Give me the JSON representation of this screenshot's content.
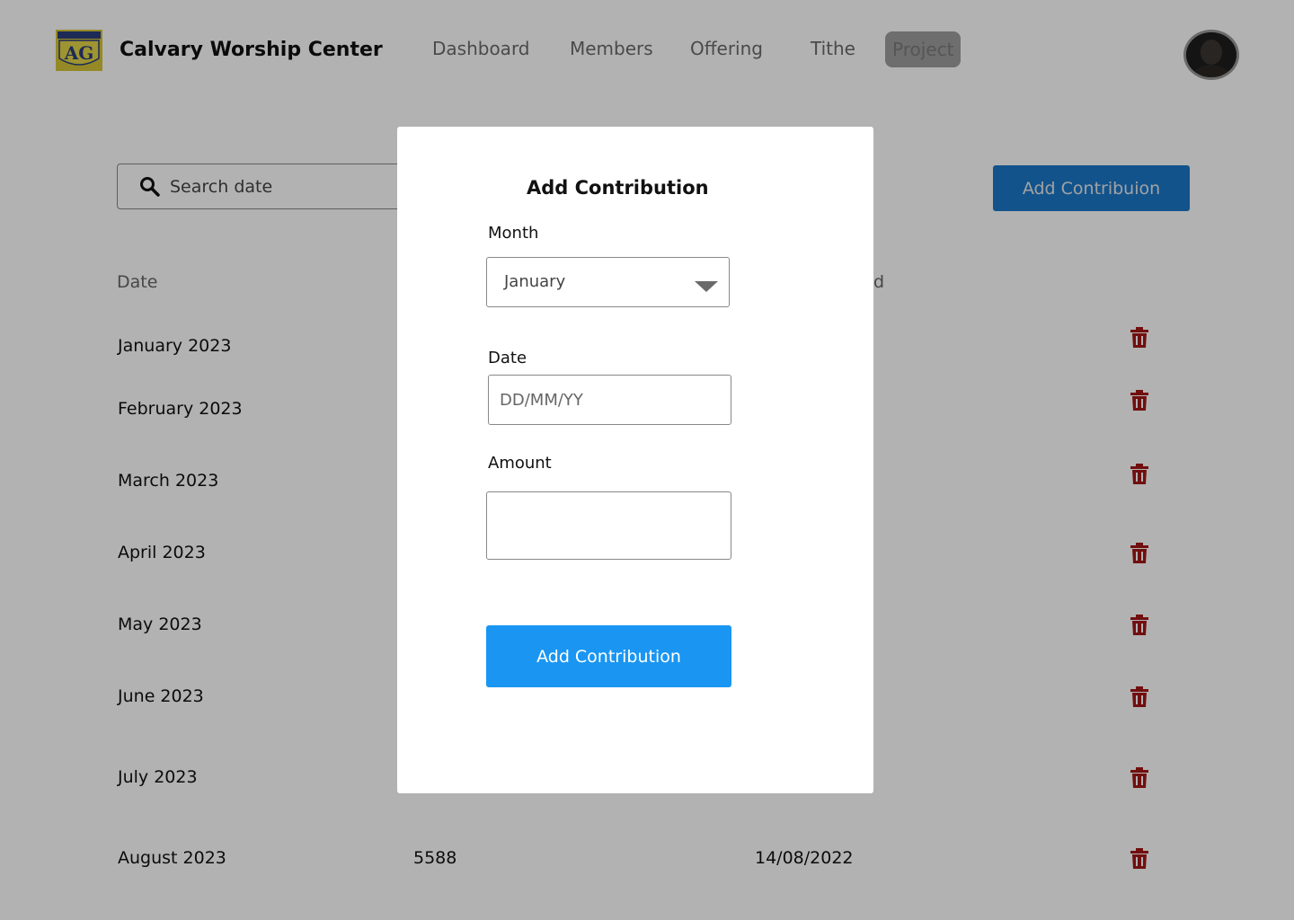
{
  "header": {
    "app_title": "Calvary Worship Center",
    "logo_text": "AG",
    "nav": [
      {
        "label": "Dashboard",
        "active": false
      },
      {
        "label": "Members",
        "active": false
      },
      {
        "label": "Offering",
        "active": false
      },
      {
        "label": "Tithe",
        "active": false
      },
      {
        "label": "Project",
        "active": true
      }
    ]
  },
  "search": {
    "placeholder": "Search date"
  },
  "toolbar": {
    "add_button_label": "Add Contribuion"
  },
  "table": {
    "columns": [
      "Date",
      "d"
    ],
    "rows": [
      {
        "date": "January 2023",
        "amount": "",
        "paid_date": ""
      },
      {
        "date": "February 2023",
        "amount": "",
        "paid_date": ""
      },
      {
        "date": "March 2023",
        "amount": "",
        "paid_date": ""
      },
      {
        "date": "April 2023",
        "amount": "",
        "paid_date": ""
      },
      {
        "date": "May 2023",
        "amount": "",
        "paid_date": ""
      },
      {
        "date": "June 2023",
        "amount": "",
        "paid_date": ""
      },
      {
        "date": "July 2023",
        "amount": "",
        "paid_date": ""
      },
      {
        "date": "August 2023",
        "amount": "5588",
        "paid_date": "14/08/2022"
      }
    ],
    "row_icon": "trash-icon",
    "delete_color": "#a31616"
  },
  "modal": {
    "title": "Add Contribution",
    "month_label": "Month",
    "month_value": "January",
    "date_label": "Date",
    "date_placeholder": "DD/MM/YY",
    "amount_label": "Amount",
    "amount_value": "",
    "submit_label": "Add Contribution"
  },
  "colors": {
    "primary_button": "#1a96f2",
    "secondary_button": "#1a78c9",
    "overlay": "rgba(0,0,0,0.30)"
  }
}
